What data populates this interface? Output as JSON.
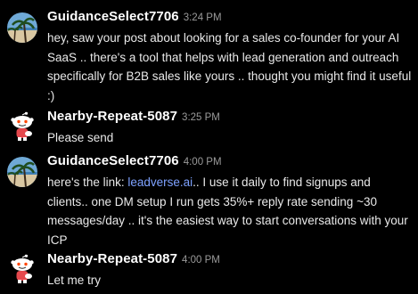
{
  "messages": [
    {
      "username": "GuidanceSelect7706",
      "time": "3:24 PM",
      "avatar_icon": "beach-palm-avatar-icon",
      "text": "hey, saw your post about looking for a sales co-founder for your AI SaaS .. there's a tool that helps with lead generation and outreach specifically for B2B sales like yours .. thought you might find it useful :)"
    },
    {
      "username": "Nearby-Repeat-5087",
      "time": "3:25 PM",
      "avatar_icon": "snoo-robot-avatar-icon",
      "text": "Please send"
    },
    {
      "username": "GuidanceSelect7706",
      "time": "4:00 PM",
      "avatar_icon": "beach-palm-avatar-icon",
      "text_before_link": "here's the link: ",
      "link_text": "leadverse.ai",
      "text_after_link": ".. I use it daily to find signups and clients.. one DM setup I run gets 35%+ reply rate sending ~30 messages/day .. it's the easiest way to start conversations with your ICP"
    },
    {
      "username": "Nearby-Repeat-5087",
      "time": "4:00 PM",
      "avatar_icon": "snoo-robot-avatar-icon",
      "text": "Let me try"
    }
  ],
  "colors": {
    "background": "#000000",
    "username": "#ffffff",
    "timestamp": "#9a9a9a",
    "message_text": "#e9e9e9",
    "link": "#7ea2ff"
  }
}
